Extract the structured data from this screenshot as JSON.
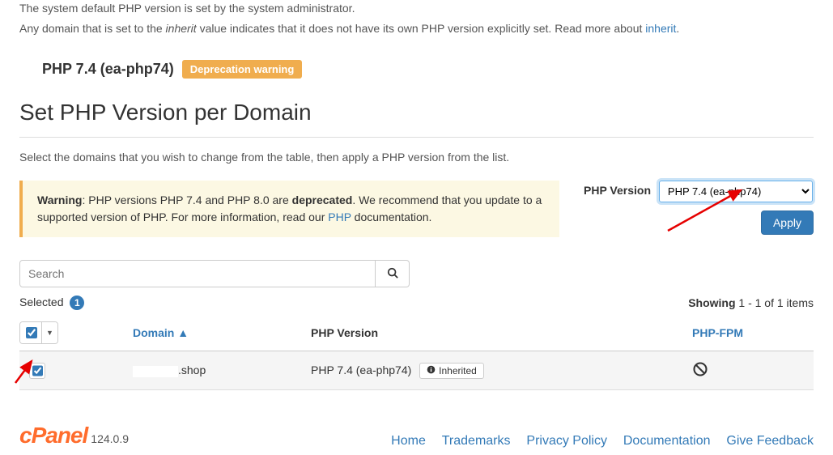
{
  "intro": {
    "line1_a": "The system default PHP version is set by the system administrator.",
    "line2_a": "Any domain that is set to the ",
    "line2_em": "inherit",
    "line2_b": " value indicates that it does not have its own PHP version explicitly set. Read more about ",
    "line2_link": "inherit",
    "line2_c": "."
  },
  "current": {
    "label": "PHP 7.4 (ea-php74)",
    "badge": "Deprecation warning"
  },
  "section": {
    "title": "Set PHP Version per Domain",
    "sub": "Select the domains that you wish to change from the table, then apply a PHP version from the list."
  },
  "callout": {
    "bold1": "Warning",
    "t1": ": PHP versions PHP 7.4 and PHP 8.0 are ",
    "bold2": "deprecated",
    "t2": ". We recommend that you update to a supported version of PHP. For more information, read our ",
    "link": "PHP",
    "t3": " documentation."
  },
  "version_panel": {
    "label": "PHP Version",
    "selected": "PHP 7.4 (ea-php74)",
    "apply": "Apply"
  },
  "search": {
    "placeholder": "Search"
  },
  "meta": {
    "selected_label": "Selected",
    "selected_count": "1",
    "showing": "Showing",
    "showing_tail": " 1 - 1 of 1 items"
  },
  "headers": {
    "domain": "Domain ▲",
    "version": "PHP Version",
    "fpm": "PHP-FPM"
  },
  "row": {
    "domain": ".shop",
    "version": "PHP 7.4 (ea-php74)",
    "inherited": "Inherited"
  },
  "footer": {
    "brand": "cPanel",
    "version": "124.0.9",
    "links": {
      "home": "Home",
      "trademarks": "Trademarks",
      "privacy": "Privacy Policy",
      "docs": "Documentation",
      "feedback": "Give Feedback"
    }
  }
}
